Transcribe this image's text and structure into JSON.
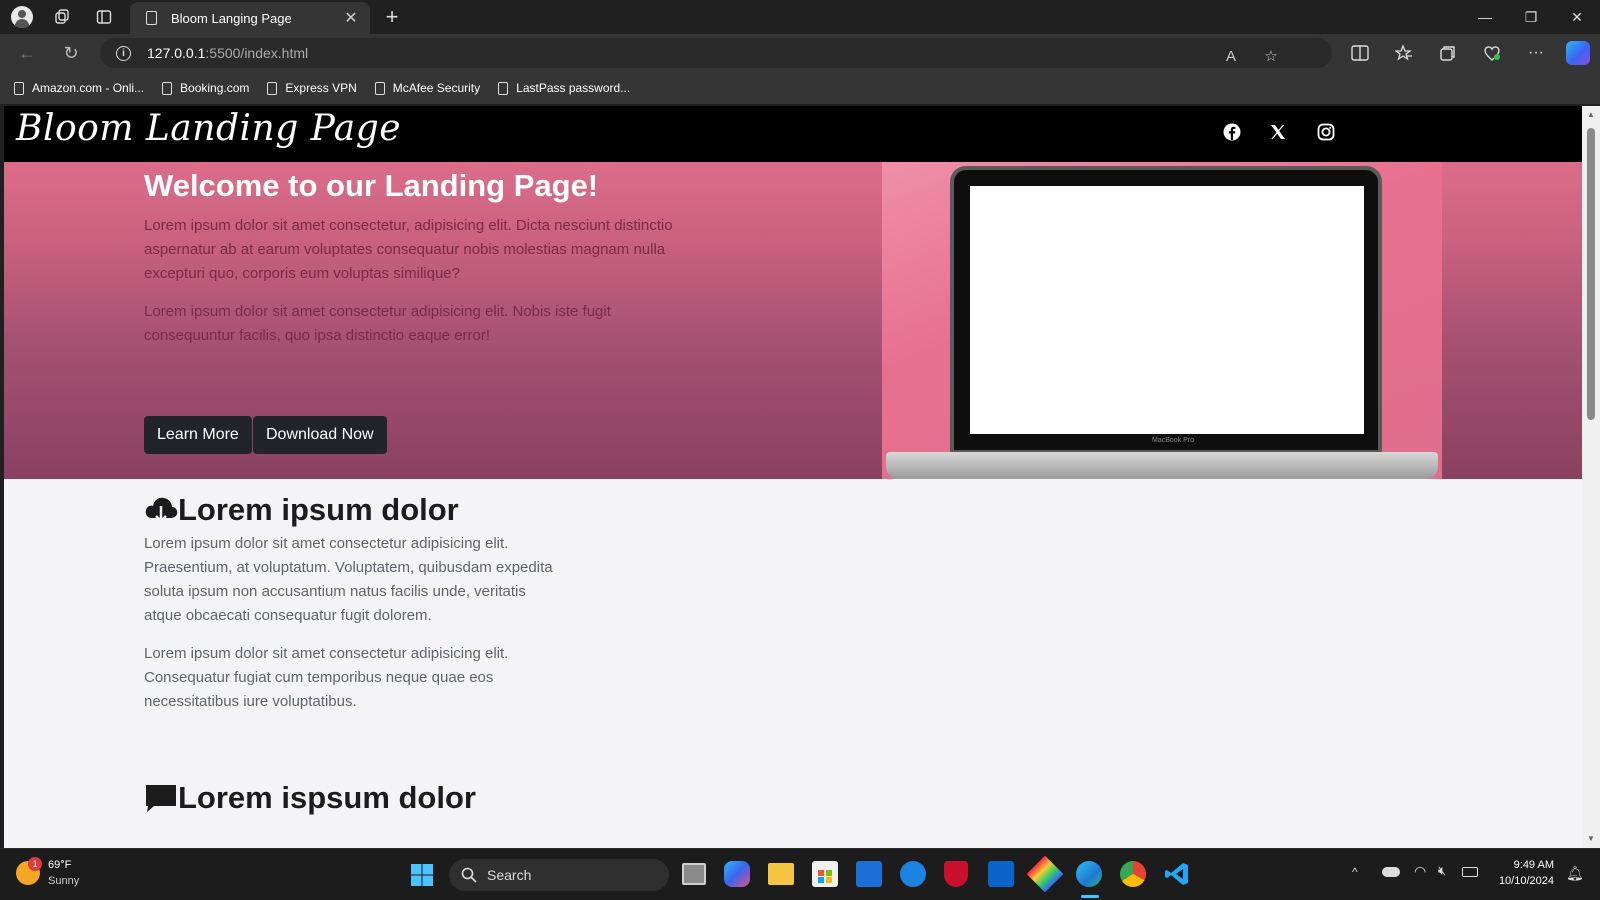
{
  "browser": {
    "tab_title": "Bloom Langing Page",
    "url_host": "127.0.0.1",
    "url_path": ":5500/index.html",
    "favorites": [
      "Amazon.com - Onli...",
      "Booking.com",
      "Express VPN",
      "McAfee Security",
      "LastPass password..."
    ]
  },
  "site": {
    "brand": "Bloom Landing Page",
    "social": [
      "facebook-icon",
      "x-icon",
      "instagram-icon"
    ],
    "hero": {
      "title": "Welcome to our Landing Page!",
      "para1": "Lorem ipsum dolor sit amet consectetur, adipisicing elit. Dicta nesciunt distinctio aspernatur ab at earum voluptates consequatur nobis molestias magnam nulla excepturi quo, corporis eum voluptas similique?",
      "para2": "Lorem ipsum dolor sit amet consectetur adipisicing elit. Nobis iste fugit consequuntur facilis, quo ipsa distinctio eaque error!",
      "btn_learn": "Learn More",
      "btn_download": "Download Now",
      "laptop_label": "MacBook Pro"
    },
    "section1": {
      "title": "Lorem ipsum dolor",
      "para1": "Lorem ipsum dolor sit amet consectetur adipisicing elit. Praesentium, at voluptatum. Voluptatem, quibusdam expedita soluta ipsum non accusantium natus facilis unde, veritatis atque obcaecati consequatur fugit dolorem.",
      "para2": "Lorem ipsum dolor sit amet consectetur adipisicing elit. Consequatur fugiat cum temporibus neque quae eos necessitatibus iure voluptatibus."
    },
    "section2": {
      "title": "Lorem ispsum dolor"
    }
  },
  "taskbar": {
    "weather_temp": "69°F",
    "weather_desc": "Sunny",
    "weather_badge": "1",
    "search_label": "Search",
    "time": "9:49 AM",
    "date": "10/10/2024"
  },
  "colors": {
    "hero_pink": "#db6d8a",
    "nav_black": "#000000",
    "button_dark": "#212529"
  }
}
